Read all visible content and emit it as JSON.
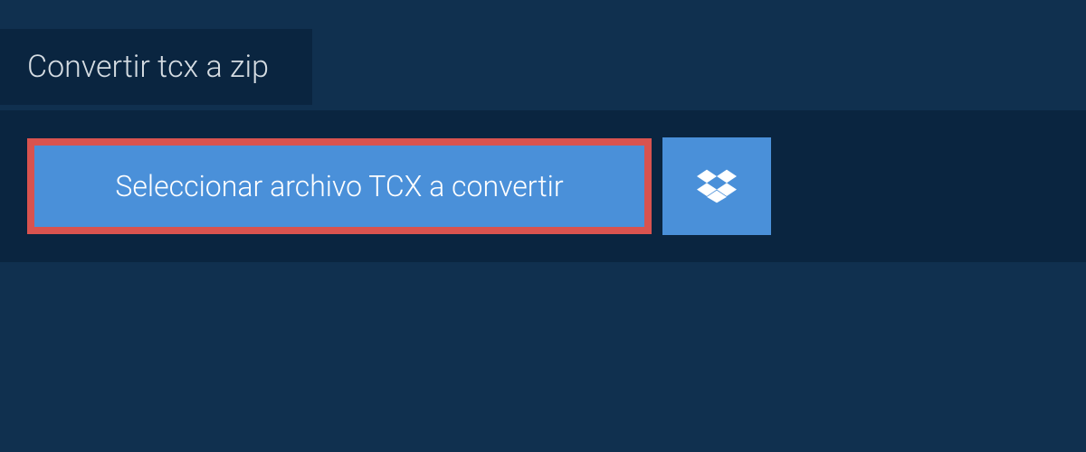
{
  "header": {
    "title": "Convertir tcx a zip"
  },
  "toolbar": {
    "select_file_label": "Seleccionar archivo TCX a convertir"
  },
  "colors": {
    "background": "#10304f",
    "panel": "#0a2540",
    "button": "#4a90d9",
    "highlight_border": "#d9534f",
    "text_light": "#d5dce2",
    "text_white": "#ffffff"
  }
}
